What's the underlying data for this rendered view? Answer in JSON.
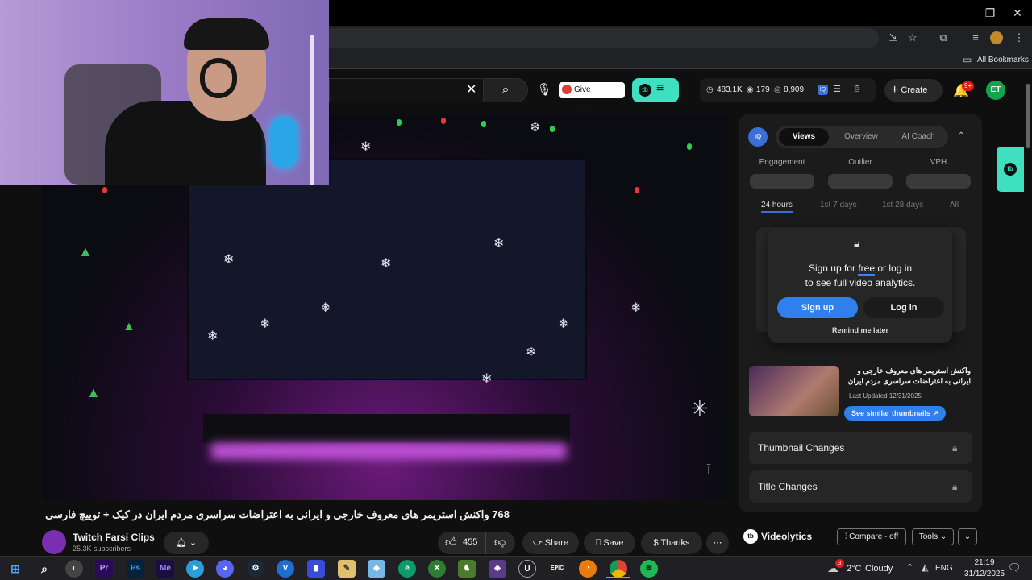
{
  "browser": {
    "bookmarks_label": "All Bookmarks"
  },
  "yt": {
    "feedback_label": "Give feedback",
    "stats": {
      "subs": "483.1K",
      "views": "179",
      "eyes": "8,909"
    },
    "create_label": "Create",
    "notif_badge": "9+",
    "avatar_initials": "ET"
  },
  "sidebar": {
    "tabs": [
      "Views",
      "Overview",
      "AI Coach"
    ],
    "metrics": [
      "Engagement",
      "Outlier",
      "VPH"
    ],
    "ranges": [
      "24 hours",
      "1st 7 days",
      "1st 28 days",
      "All"
    ],
    "lock_text_1": "Sign up for ",
    "lock_text_free": "free",
    "lock_text_2": " or log in",
    "lock_text_3": "to see full video analytics.",
    "signup_label": "Sign up",
    "login_label": "Log in",
    "remind_label": "Remind me later",
    "thumb_title": "واکنش استریمر های معروف خارجی و ایرانی به اعتراضات سراسری مردم ایران در ...",
    "thumb_updated": "Last Updated 12/31/2025",
    "similar_label": "See similar thumbnails",
    "thumb_changes": "Thumbnail Changes",
    "title_changes": "Title Changes"
  },
  "video": {
    "title": "768 واکنش استریمر های معروف خارجی و ایرانی به اعتراضات سراسری مردم ایران در کیک + توییچ فارسی ❄️",
    "channel_name": "Twitch Farsi Clips",
    "subscribers": "25.3K subscribers",
    "likes": "455",
    "share_label": "Share",
    "save_label": "Save",
    "thanks_label": "Thanks"
  },
  "videolytics": {
    "brand": "Videolytics",
    "compare_label": "Compare - off",
    "tools_label": "Tools"
  },
  "taskbar": {
    "weather_temp": "2°C",
    "weather_desc": "Cloudy",
    "weather_badge": "3",
    "lang": "ENG",
    "time": "21:19",
    "date": "31/12/2025",
    "apps": [
      "Pr",
      "Ps",
      "Me",
      "EPIC"
    ]
  }
}
